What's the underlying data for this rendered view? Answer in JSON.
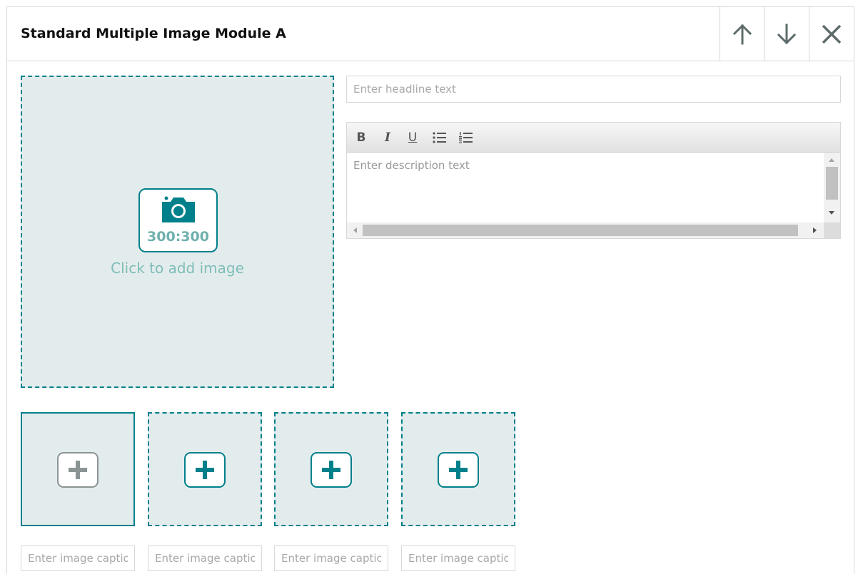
{
  "module": {
    "title": "Standard Multiple Image Module A",
    "header_buttons": {
      "move_up": "arrow-up-icon",
      "move_down": "arrow-down-icon",
      "remove": "close-icon"
    }
  },
  "main_image": {
    "ratio": "300:300",
    "prompt": "Click to add image",
    "icon": "camera-icon"
  },
  "headline": {
    "placeholder": "Enter headline text",
    "value": ""
  },
  "description": {
    "placeholder": "Enter description text",
    "value": "",
    "toolbar": {
      "bold": "B",
      "italic": "I",
      "underline": "U",
      "bulleted_list": "bulleted-list-icon",
      "numbered_list": "numbered-list-icon"
    }
  },
  "thumbnails": [
    {
      "icon": "plus-icon",
      "selected": true,
      "caption_placeholder": "Enter image caption"
    },
    {
      "icon": "plus-icon",
      "selected": false,
      "caption_placeholder": "Enter image caption"
    },
    {
      "icon": "plus-icon",
      "selected": false,
      "caption_placeholder": "Enter image caption"
    },
    {
      "icon": "plus-icon",
      "selected": false,
      "caption_placeholder": "Enter image caption"
    }
  ],
  "colors": {
    "accent": "#00808b",
    "tile_background": "#e3ecec",
    "border": "#d5d9d9",
    "icon_grey": "#5f6b6b",
    "disabled_plus": "#8b9494"
  }
}
